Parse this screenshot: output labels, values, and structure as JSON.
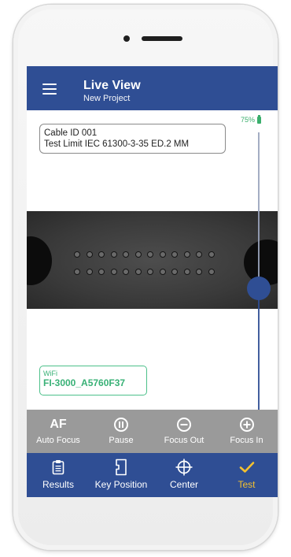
{
  "header": {
    "title": "Live View",
    "subtitle": "New Project"
  },
  "battery": {
    "level": "75%"
  },
  "info": {
    "cable_id": "Cable ID 001",
    "test_limit": "Test Limit IEC 61300-3-35 ED.2 MM"
  },
  "wifi": {
    "label": "WiFi",
    "network": "FI-3000_A5760F37"
  },
  "toolbar": {
    "items": [
      {
        "icon": "AF",
        "label": "Auto Focus"
      },
      {
        "icon": "pause-icon",
        "label": "Pause"
      },
      {
        "icon": "minus-circle-icon",
        "label": "Focus Out"
      },
      {
        "icon": "plus-circle-icon",
        "label": "Focus In"
      }
    ]
  },
  "nav": {
    "items": [
      {
        "icon": "clipboard-icon",
        "label": "Results"
      },
      {
        "icon": "key-position-icon",
        "label": "Key Position"
      },
      {
        "icon": "crosshair-icon",
        "label": "Center"
      },
      {
        "icon": "check-icon",
        "label": "Test"
      }
    ],
    "active_index": 3
  },
  "focus_slider": {
    "level": 0.49
  },
  "colors": {
    "primary": "#2f4e94",
    "accent": "#f4c12f",
    "wifi": "#38b176",
    "toolbar": "#9a9a9a"
  }
}
